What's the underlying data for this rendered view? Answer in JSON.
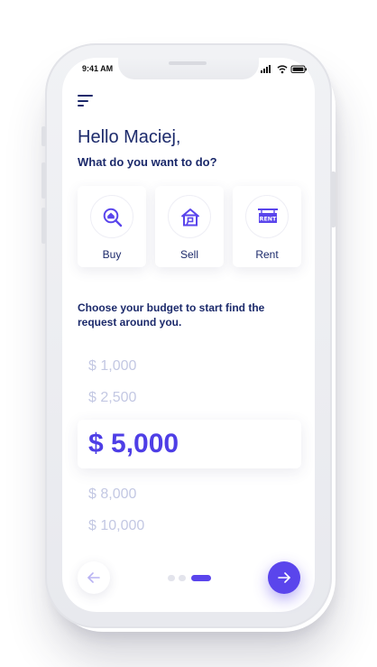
{
  "status_bar": {
    "time": "9:41 AM"
  },
  "header": {
    "greeting": "Hello Maciej,",
    "question": "What do you want to do?"
  },
  "actions": [
    {
      "label": "Buy",
      "icon": "house-search-icon"
    },
    {
      "label": "Sell",
      "icon": "house-sell-icon"
    },
    {
      "label": "Rent",
      "icon": "rent-sign-icon",
      "icon_text": "RENT"
    }
  ],
  "budget": {
    "prompt": "Choose your budget to start find the request around you.",
    "options": [
      "$ 1,000",
      "$ 2,500",
      "$ 5,000",
      "$ 8,000",
      "$ 10,000"
    ],
    "selected": "$ 5,000"
  },
  "pagination": {
    "total": 3,
    "current": 3
  },
  "colors": {
    "primary": "#5a45ec",
    "text_dark": "#1c2a6b",
    "muted": "#c3c8e3"
  }
}
